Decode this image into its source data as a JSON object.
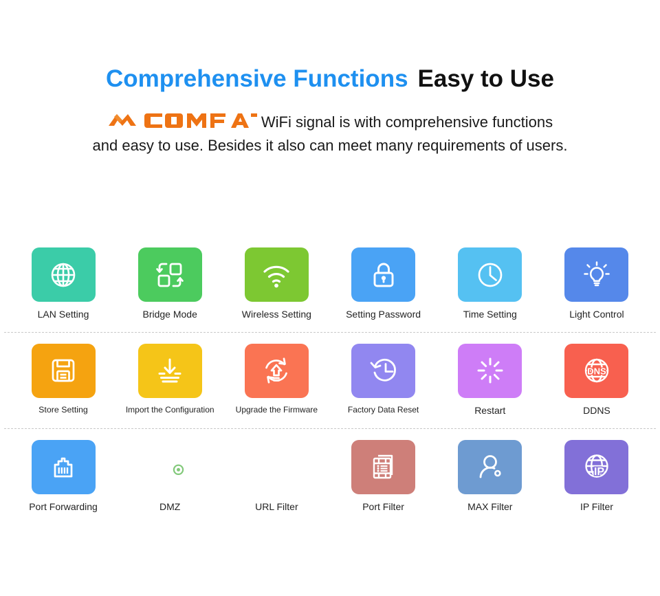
{
  "header": {
    "headline_blue": "Comprehensive Functions",
    "headline_black": "Easy to Use",
    "brand": "COMFAST",
    "subcopy_line1": "WiFi signal is with comprehensive functions",
    "subcopy_line2": "and easy to use. Besides it also can meet many requirements of users.",
    "brand_color": "#EE7314",
    "headline_blue_color": "#1E90F0",
    "headline_black_color": "#111111"
  },
  "grid": {
    "rows": [
      {
        "cells": [
          {
            "label": "LAN Setting",
            "icon": "globe-icon",
            "color": "#3BCCA8"
          },
          {
            "label": "Bridge Mode",
            "icon": "bridge-swap-icon",
            "color": "#4CCB5E"
          },
          {
            "label": "Wireless Setting",
            "icon": "wifi-signal-icon",
            "color": "#7DC832"
          },
          {
            "label": "Setting Password",
            "icon": "padlock-icon",
            "color": "#4AA3F5"
          },
          {
            "label": "Time Setting",
            "icon": "clock-icon",
            "color": "#55C1F2"
          },
          {
            "label": "Light Control",
            "icon": "lightbulb-icon",
            "color": "#5588EA"
          }
        ]
      },
      {
        "cells": [
          {
            "label": "Store Setting",
            "icon": "floppy-disk-icon",
            "color": "#F5A310"
          },
          {
            "label": "Import the Configuration",
            "icon": "download-arrow-icon",
            "color": "#F5C518"
          },
          {
            "label": "Upgrade the Firmware",
            "icon": "upgrade-circle-icon",
            "color": "#FA7453"
          },
          {
            "label": "Factory Data Reset",
            "icon": "clock-restore-icon",
            "color": "#9187F0"
          },
          {
            "label": "Restart",
            "icon": "spinner-icon",
            "color": "#CE7DF7"
          },
          {
            "label": "DDNS",
            "icon": "dns-globe-icon",
            "color": "#F8604F"
          }
        ]
      },
      {
        "cells": [
          {
            "label": "Port Forwarding",
            "icon": "ethernet-port-icon",
            "color": "#4AA3F5"
          },
          {
            "label": "DMZ",
            "icon": "globe-gear-icon",
            "color": "#80C濾75"
          },
          {
            "label": "URL Filter",
            "icon": "paperclip-icon",
            "color": "#D5B濾76"
          },
          {
            "label": "Port Filter",
            "icon": "document-list-icon",
            "color": "#CE7F79"
          },
          {
            "label": "MAX Filter",
            "icon": "person-gear-icon",
            "color": "#6E9BD1"
          },
          {
            "label": "IP Filter",
            "icon": "ip-globe-icon",
            "color": "#8270D8"
          }
        ]
      }
    ]
  }
}
